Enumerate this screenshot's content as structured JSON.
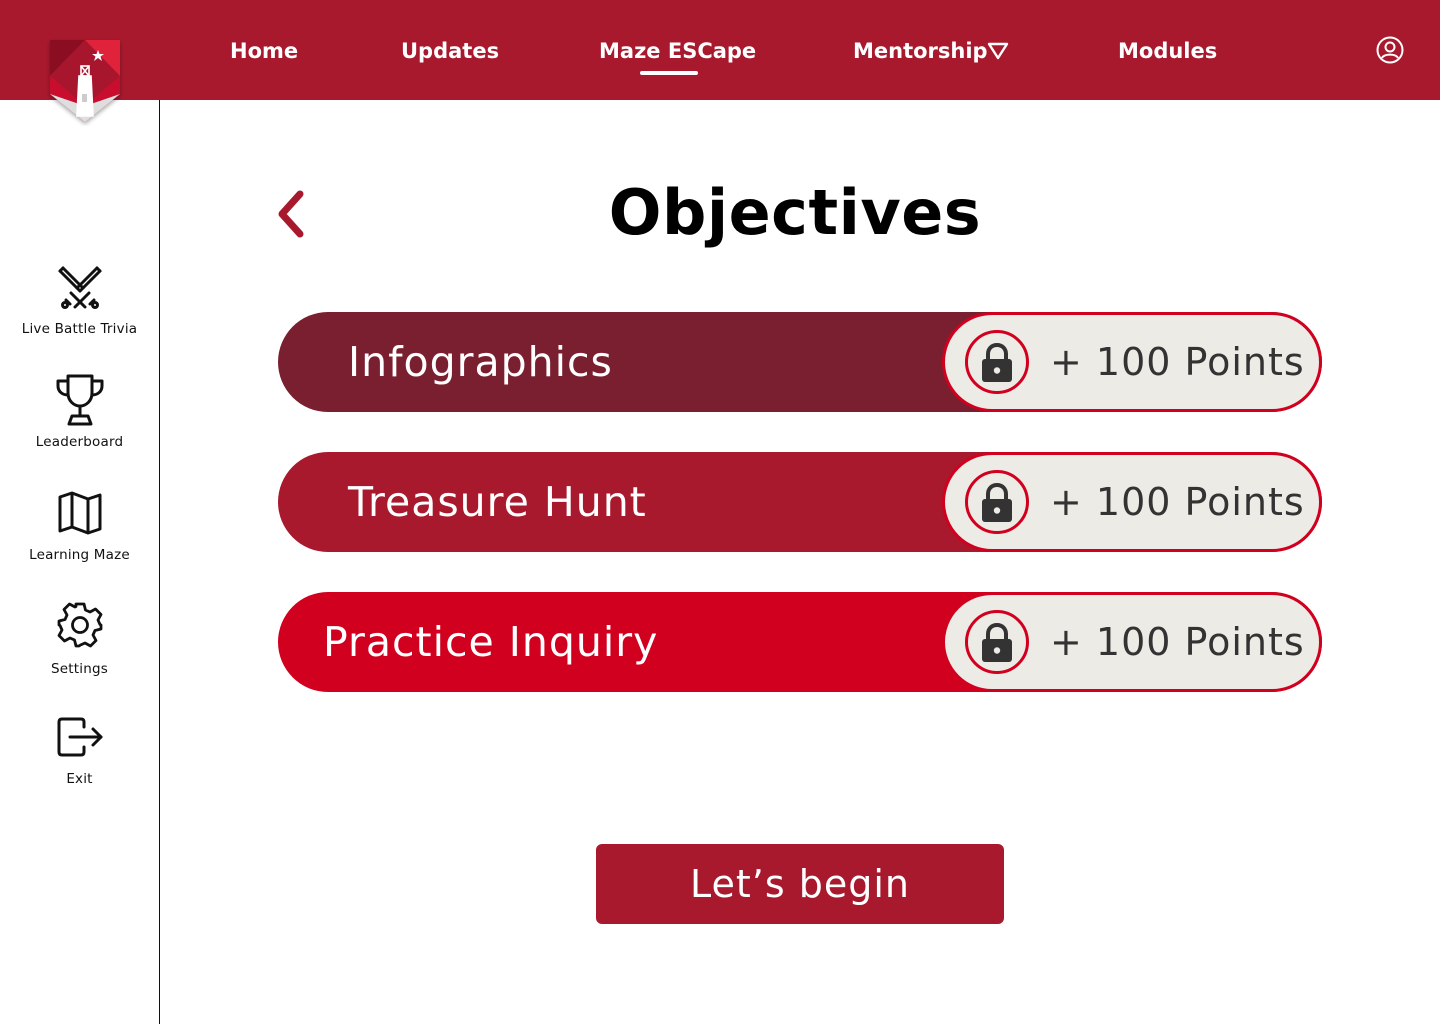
{
  "nav": {
    "items": [
      {
        "label": "Home"
      },
      {
        "label": "Updates"
      },
      {
        "label": "Maze ESCape"
      },
      {
        "label": "Mentorship"
      },
      {
        "label": "Modules"
      }
    ],
    "active": "Maze ESCape"
  },
  "sidebar": {
    "items": [
      {
        "label": "Live Battle Trivia",
        "icon": "crossed-swords-icon"
      },
      {
        "label": "Leaderboard",
        "icon": "trophy-icon"
      },
      {
        "label": "Learning Maze",
        "icon": "map-icon"
      },
      {
        "label": "Settings",
        "icon": "gear-icon"
      },
      {
        "label": "Exit",
        "icon": "exit-icon"
      }
    ]
  },
  "main": {
    "title": "Objectives",
    "objectives": [
      {
        "name": "Infographics",
        "points": "+ 100 Points",
        "color": "#7a1f2f"
      },
      {
        "name": "Treasure Hunt",
        "points": "+ 100 Points",
        "color": "#a8192e"
      },
      {
        "name": "Practice Inquiry",
        "points": "+ 100 Points",
        "color": "#d1001e"
      }
    ],
    "begin_label": "Let’s begin"
  },
  "colors": {
    "brand": "#a8192e",
    "accent": "#d1001e",
    "pill_bg": "#ecebe6"
  }
}
